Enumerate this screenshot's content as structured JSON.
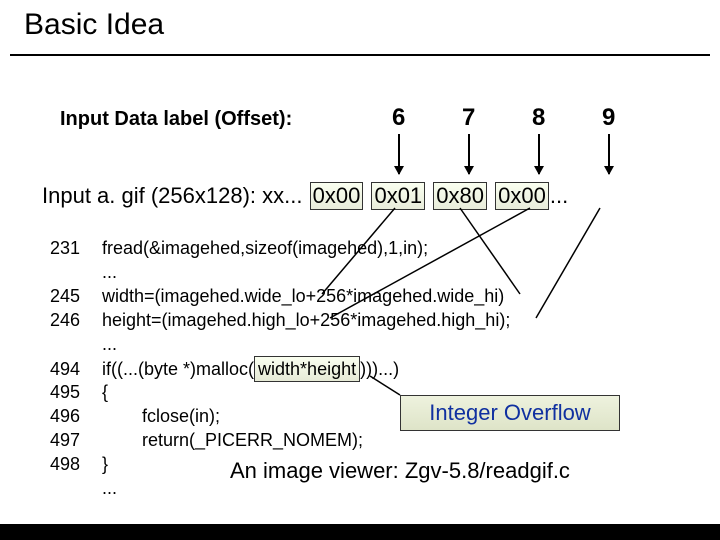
{
  "title": "Basic Idea",
  "offset_label": "Input Data label (Offset):",
  "offsets": {
    "n6": "6",
    "n7": "7",
    "n8": "8",
    "n9": "9"
  },
  "input_line_prefix": "Input a. gif (256x128): xx...",
  "hex": {
    "b0": "0x00",
    "b1": "0x01",
    "b2": "0x80",
    "b3": "0x00"
  },
  "input_line_suffix": "...",
  "code": {
    "l231": "231",
    "c231": "fread(&imagehed,sizeof(imagehed),1,in);",
    "cdots1": "...",
    "l245": "245",
    "c245": "width=(imagehed.wide_lo+256*imagehed.wide_hi)",
    "l246": "246",
    "c246": "height=(imagehed.high_lo+256*imagehed.high_hi);",
    "cdots2": "...",
    "l494": "494",
    "c494a": "if((...(byte *)malloc",
    "c494b": "width*height",
    "c494c": "))...)",
    "l495": "495",
    "c495": "{",
    "l496": "496",
    "c496": "fclose(in);",
    "l497": "497",
    "c497": "return(_PICERR_NOMEM);",
    "l498": "498",
    "c498": "}",
    "cdots3": "..."
  },
  "callout": "Integer Overflow",
  "viewer": "An image viewer: Zgv-5.8/readgif.c"
}
